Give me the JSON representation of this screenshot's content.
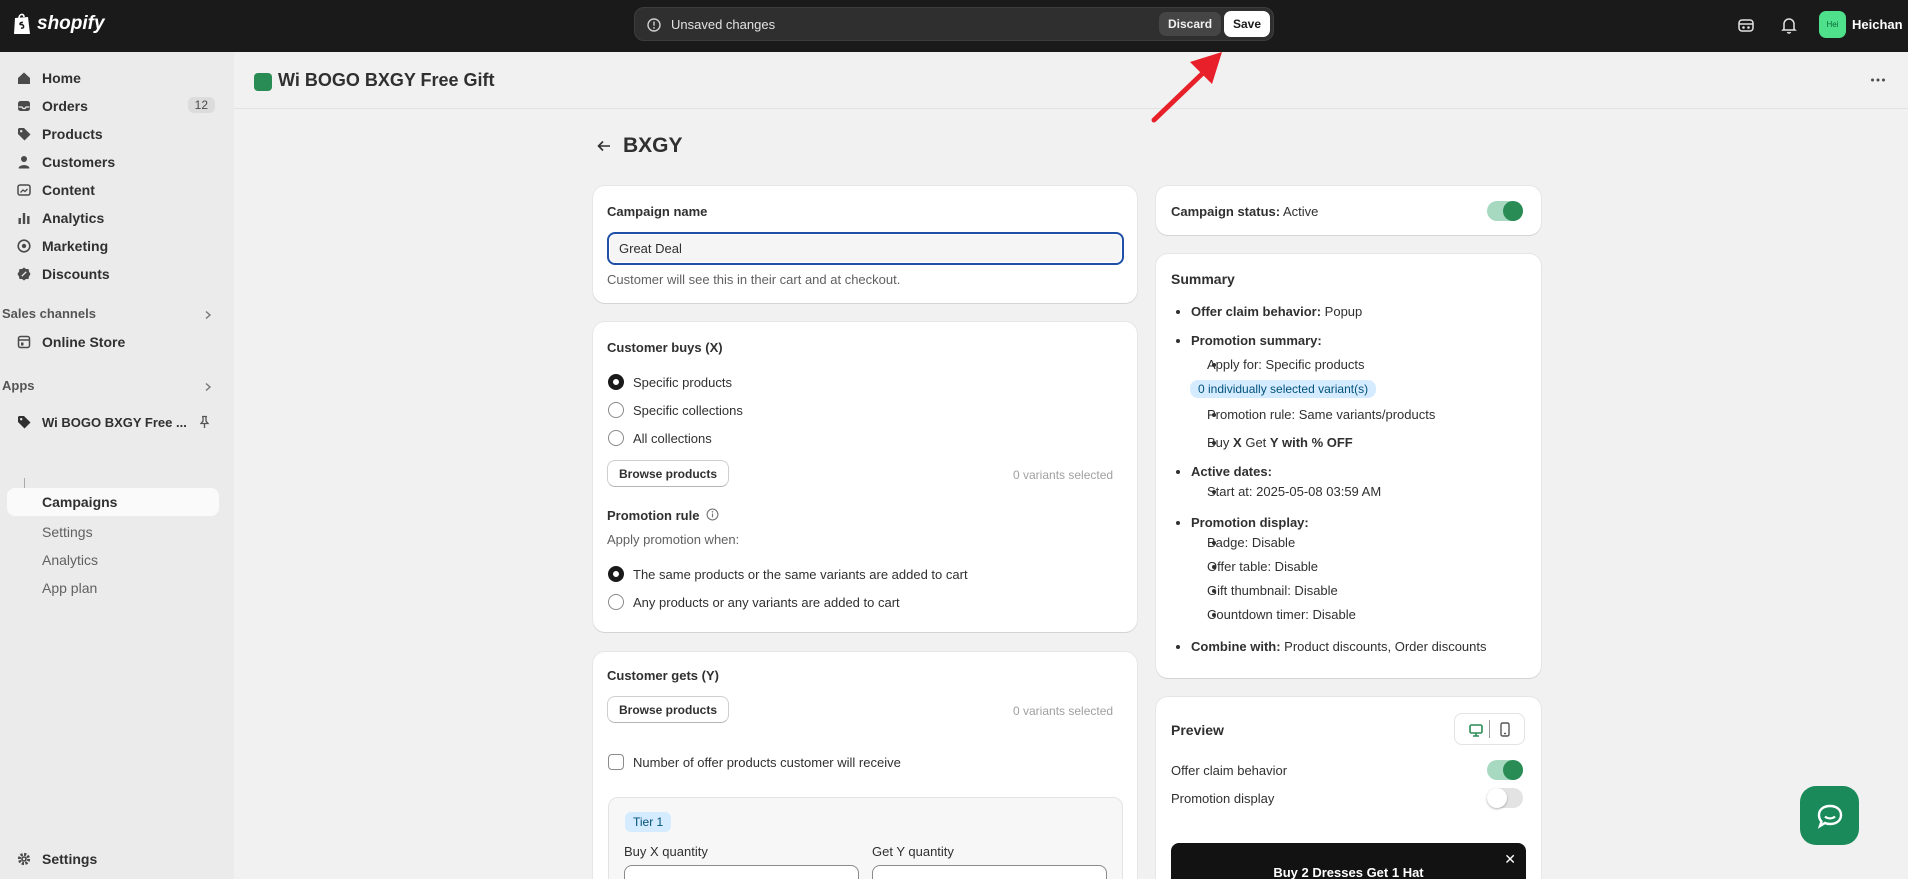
{
  "topbar": {
    "brand": "shopify",
    "unsaved_message": "Unsaved changes",
    "discard_label": "Discard",
    "save_label": "Save",
    "avatar_initials": "Hei",
    "user_name": "Heichan"
  },
  "sidebar": {
    "items": [
      {
        "label": "Home",
        "icon": "home-icon"
      },
      {
        "label": "Orders",
        "icon": "inbox-icon",
        "badge": "12"
      },
      {
        "label": "Products",
        "icon": "tag-icon"
      },
      {
        "label": "Customers",
        "icon": "person-icon"
      },
      {
        "label": "Content",
        "icon": "content-icon"
      },
      {
        "label": "Analytics",
        "icon": "bar-chart-icon"
      },
      {
        "label": "Marketing",
        "icon": "target-icon"
      },
      {
        "label": "Discounts",
        "icon": "discount-icon"
      }
    ],
    "sales_channels_title": "Sales channels",
    "online_store": "Online Store",
    "apps_title": "Apps",
    "app_name": "Wi BOGO BXGY Free ...",
    "app_sub_items": [
      "Campaigns",
      "Settings",
      "Analytics",
      "App plan"
    ],
    "settings": "Settings"
  },
  "header": {
    "app_title": "Wi BOGO BXGY Free Gift"
  },
  "page": {
    "title": "BXGY"
  },
  "campaign_name": {
    "title": "Campaign name",
    "value": "Great Deal",
    "help": "Customer will see this in their cart and at checkout."
  },
  "customer_buys": {
    "title": "Customer buys (X)",
    "options": [
      "Specific products",
      "Specific collections",
      "All collections"
    ],
    "selected": 0,
    "browse_label": "Browse products",
    "variants_selected": "0 variants selected",
    "promotion_rule_title": "Promotion rule",
    "apply_when": "Apply promotion when:",
    "rule_options": [
      "The same products or the same variants are added to cart",
      "Any products or any variants are added to cart"
    ],
    "rule_selected": 0
  },
  "customer_gets": {
    "title": "Customer gets (Y)",
    "browse_label": "Browse products",
    "variants_selected": "0 variants selected",
    "checkbox_label": "Number of offer products customer will receive",
    "tier_label": "Tier 1",
    "buy_qty_label": "Buy X quantity",
    "get_qty_label": "Get Y quantity"
  },
  "status": {
    "label": "Campaign status:",
    "value": "Active",
    "enabled": true
  },
  "summary": {
    "title": "Summary",
    "offer_claim_label": "Offer claim behavior:",
    "offer_claim_value": "Popup",
    "promotion_summary_label": "Promotion summary:",
    "apply_for": "Apply for: Specific products",
    "variants_pill": "0 individually selected variant(s)",
    "promotion_rule": "Promotion rule: Same variants/products",
    "buy_prefix": "Buy",
    "buy_x": "X",
    "get_word": "Get",
    "get_y": "Y with % OFF",
    "active_dates_label": "Active dates:",
    "start_at": "Start at: 2025-05-08 03:59 AM",
    "promotion_display_label": "Promotion display:",
    "display_items": [
      "Badge: Disable",
      "Offer table: Disable",
      "Gift thumbnail: Disable",
      "Countdown timer: Disable"
    ],
    "combine_label": "Combine with:",
    "combine_value": "Product discounts, Order discounts"
  },
  "preview": {
    "title": "Preview",
    "offer_claim_label": "Offer claim behavior",
    "offer_claim_enabled": true,
    "promotion_display_label": "Promotion display",
    "promotion_display_enabled": false,
    "banner_text": "Buy 2 Dresses Get 1 Hat",
    "close_glyph": "✕"
  },
  "colors": {
    "accent_green": "#2a8c55",
    "topbar": "#1a1a1a",
    "focus_blue": "#1f4fa6",
    "annotation_red": "#e8202a"
  }
}
